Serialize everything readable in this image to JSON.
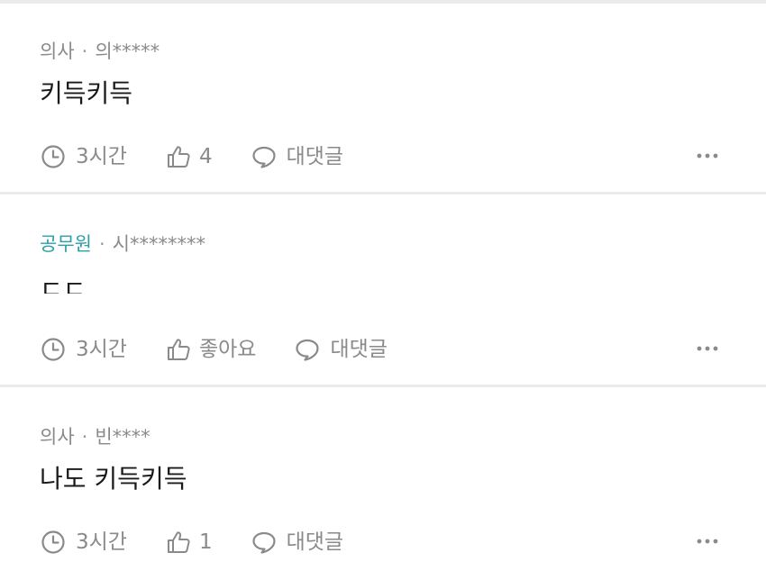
{
  "comments": [
    {
      "job": "의사",
      "separator": "·",
      "user": "의*****",
      "text": "키득키득",
      "time": "3시간",
      "likes": "4",
      "reply": "대댓글"
    },
    {
      "job": "공무원",
      "separator": "·",
      "user": "시********",
      "text": "ㄷㄷ",
      "time": "3시간",
      "likes": "좋아요",
      "reply": "대댓글"
    },
    {
      "job": "의사",
      "separator": "·",
      "user": "빈****",
      "text": "나도 키득키득",
      "time": "3시간",
      "likes": "1",
      "reply": "대댓글"
    }
  ],
  "colors": {
    "job_highlight": "#2ba0a8",
    "meta_gray": "#8a8a8a",
    "text_dark": "#1a1a1a",
    "divider": "#ebebeb"
  },
  "icons": {
    "time": "clock-icon",
    "like": "thumbs-up-icon",
    "reply": "speech-bubble-icon",
    "more": "more-dots-icon"
  }
}
